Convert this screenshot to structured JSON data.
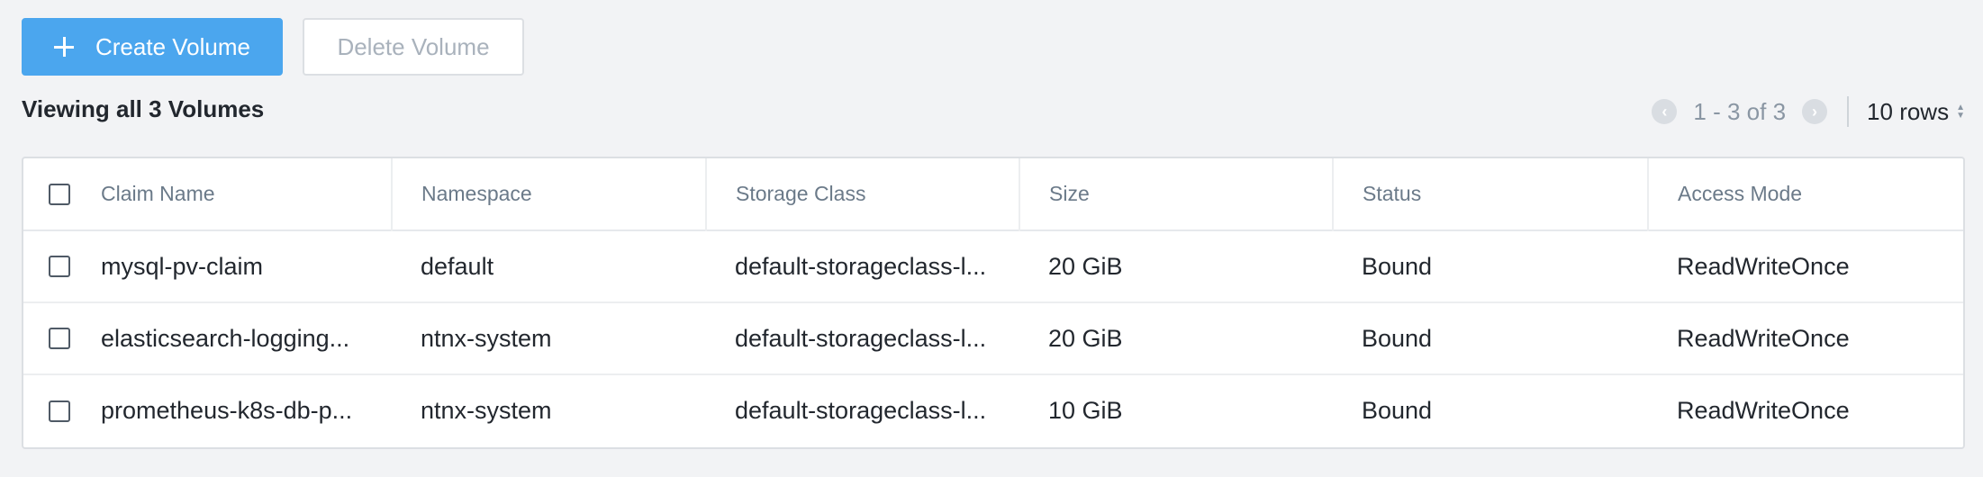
{
  "toolbar": {
    "create_label": "Create Volume",
    "delete_label": "Delete Volume"
  },
  "summary": "Viewing all 3 Volumes",
  "pagination": {
    "prev_icon": "‹",
    "next_icon": "›",
    "range": "1 - 3 of 3",
    "rows_label": "10 rows"
  },
  "table": {
    "headers": {
      "claim_name": "Claim Name",
      "namespace": "Namespace",
      "storage_class": "Storage Class",
      "size": "Size",
      "status": "Status",
      "access_mode": "Access Mode"
    },
    "rows": [
      {
        "claim_name": "mysql-pv-claim",
        "namespace": "default",
        "storage_class": "default-storageclass-l...",
        "size": "20 GiB",
        "status": "Bound",
        "access_mode": "ReadWriteOnce"
      },
      {
        "claim_name": "elasticsearch-logging...",
        "namespace": "ntnx-system",
        "storage_class": "default-storageclass-l...",
        "size": "20 GiB",
        "status": "Bound",
        "access_mode": "ReadWriteOnce"
      },
      {
        "claim_name": "prometheus-k8s-db-p...",
        "namespace": "ntnx-system",
        "storage_class": "default-storageclass-l...",
        "size": "10 GiB",
        "status": "Bound",
        "access_mode": "ReadWriteOnce"
      }
    ]
  },
  "colors": {
    "primary": "#4ba6ee",
    "background": "#f2f3f5",
    "header_text": "#6b7a89"
  }
}
